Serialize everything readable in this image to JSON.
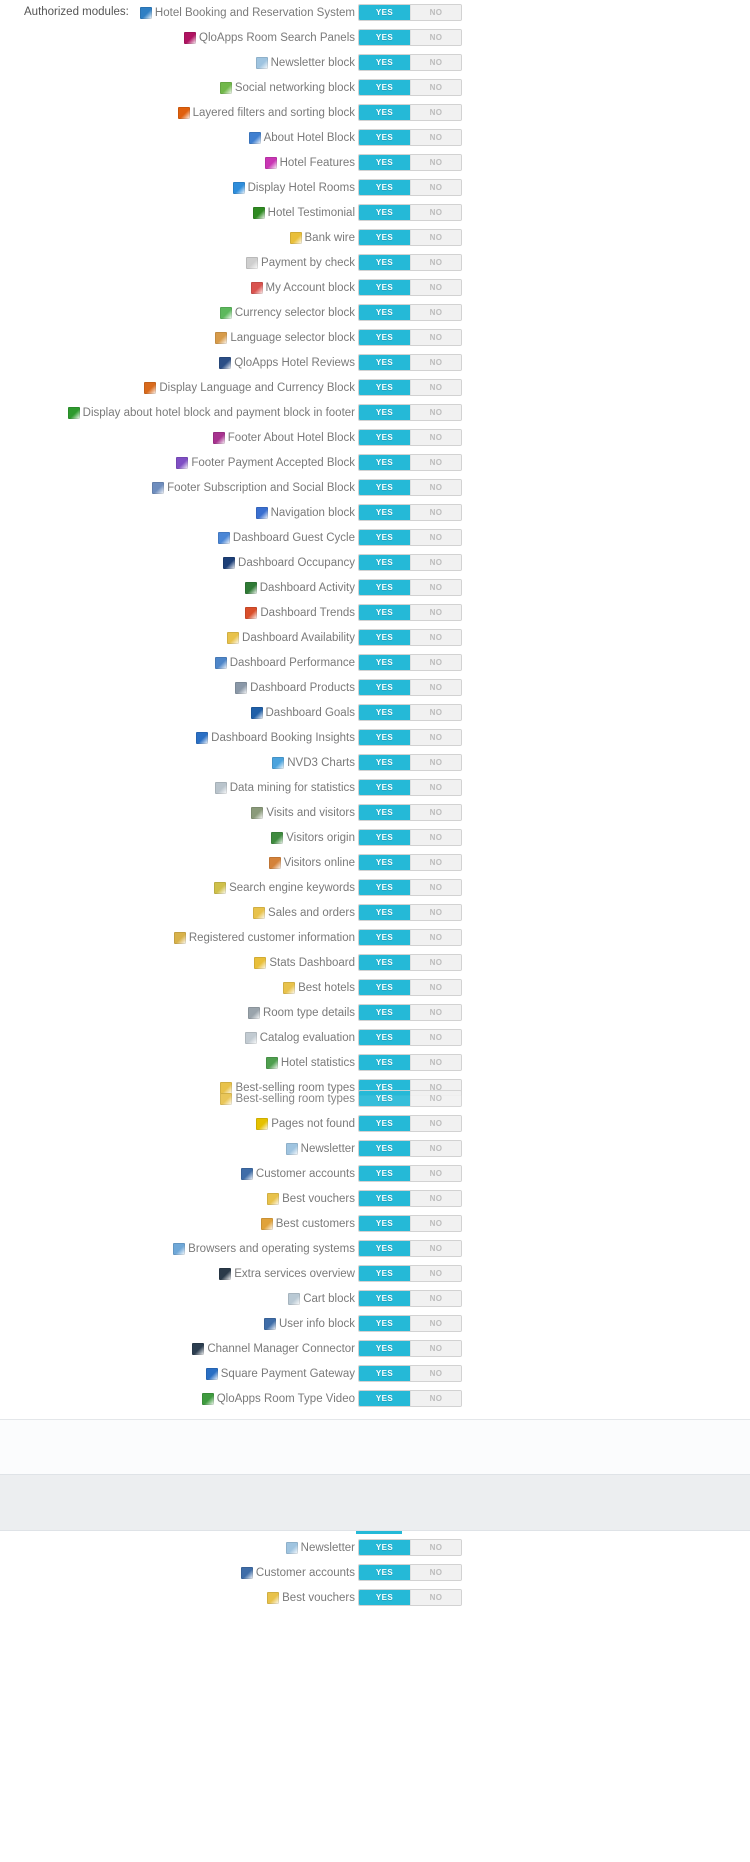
{
  "form": {
    "label": "Authorized modules:"
  },
  "toggle": {
    "yes_label": "YES",
    "no_label": "NO",
    "accent_color": "#25b9d7",
    "off_color": "#f1f1f1"
  },
  "modules": [
    {
      "name": "Hotel Booking and Reservation System",
      "icon": "hotel-booking-icon",
      "icon_color": "#2e7fc4",
      "value": "yes"
    },
    {
      "name": "QloApps Room Search Panels",
      "icon": "room-search-icon",
      "icon_color": "#b01361",
      "value": "yes"
    },
    {
      "name": "Newsletter block",
      "icon": "envelope-icon",
      "icon_color": "#9fc4e0",
      "value": "yes"
    },
    {
      "name": "Social networking block",
      "icon": "social-network-icon",
      "icon_color": "#71b84a",
      "value": "yes"
    },
    {
      "name": "Layered filters and sorting block",
      "icon": "filter-icon",
      "icon_color": "#e0600d",
      "value": "yes"
    },
    {
      "name": "About Hotel Block",
      "icon": "about-hotel-icon",
      "icon_color": "#3f7fd0",
      "value": "yes"
    },
    {
      "name": "Hotel Features",
      "icon": "hotel-features-icon",
      "icon_color": "#c936b4",
      "value": "yes"
    },
    {
      "name": "Display Hotel Rooms",
      "icon": "bed-icon",
      "icon_color": "#2e8ddb",
      "value": "yes"
    },
    {
      "name": "Hotel Testimonial",
      "icon": "testimonial-icon",
      "icon_color": "#2f8a22",
      "value": "yes"
    },
    {
      "name": "Bank wire",
      "icon": "bank-wire-icon",
      "icon_color": "#e9bf3a",
      "value": "yes"
    },
    {
      "name": "Payment by check",
      "icon": "check-payment-icon",
      "icon_color": "#cfcfcf",
      "value": "yes"
    },
    {
      "name": "My Account block",
      "icon": "my-account-icon",
      "icon_color": "#d9534f",
      "value": "yes"
    },
    {
      "name": "Currency selector block",
      "icon": "currency-icon",
      "icon_color": "#5cb85c",
      "value": "yes"
    },
    {
      "name": "Language selector block",
      "icon": "language-icon",
      "icon_color": "#d79b4a",
      "value": "yes"
    },
    {
      "name": "QloApps Hotel Reviews",
      "icon": "hotel-reviews-icon",
      "icon_color": "#2b4e86",
      "value": "yes"
    },
    {
      "name": "Display Language and Currency Block",
      "icon": "lang-currency-icon",
      "icon_color": "#d96a1c",
      "value": "yes"
    },
    {
      "name": "Display about hotel block and payment block in footer",
      "icon": "footer-about-payment-icon",
      "icon_color": "#2e9a2e",
      "value": "yes"
    },
    {
      "name": "Footer About Hotel Block",
      "icon": "footer-about-icon",
      "icon_color": "#a7338f",
      "value": "yes"
    },
    {
      "name": "Footer Payment Accepted Block",
      "icon": "payment-card-icon",
      "icon_color": "#7f4fc4",
      "value": "yes"
    },
    {
      "name": "Footer Subscription and Social Block",
      "icon": "subscription-social-icon",
      "icon_color": "#6e8dbe",
      "value": "yes"
    },
    {
      "name": "Navigation block",
      "icon": "navigation-icon",
      "icon_color": "#3a6fd0",
      "value": "yes"
    },
    {
      "name": "Dashboard Guest Cycle",
      "icon": "guest-cycle-icon",
      "icon_color": "#4a86d6",
      "value": "yes"
    },
    {
      "name": "Dashboard Occupancy",
      "icon": "occupancy-icon",
      "icon_color": "#1c3f77",
      "value": "yes"
    },
    {
      "name": "Dashboard Activity",
      "icon": "activity-icon",
      "icon_color": "#2f7a35",
      "value": "yes"
    },
    {
      "name": "Dashboard Trends",
      "icon": "trends-icon",
      "icon_color": "#d94f2b",
      "value": "yes"
    },
    {
      "name": "Dashboard Availability",
      "icon": "availability-icon",
      "icon_color": "#e8c24b",
      "value": "yes"
    },
    {
      "name": "Dashboard Performance",
      "icon": "performance-icon",
      "icon_color": "#4e86c9",
      "value": "yes"
    },
    {
      "name": "Dashboard Products",
      "icon": "products-icon",
      "icon_color": "#8a98a8",
      "value": "yes"
    },
    {
      "name": "Dashboard Goals",
      "icon": "goals-icon",
      "icon_color": "#1f5fa8",
      "value": "yes"
    },
    {
      "name": "Dashboard Booking Insights",
      "icon": "booking-insights-icon",
      "icon_color": "#2a6fc4",
      "value": "yes"
    },
    {
      "name": "NVD3 Charts",
      "icon": "nvd3-charts-icon",
      "icon_color": "#4ba3dd",
      "value": "yes"
    },
    {
      "name": "Data mining for statistics",
      "icon": "data-mining-icon",
      "icon_color": "#b9c4cc",
      "value": "yes"
    },
    {
      "name": "Visits and visitors",
      "icon": "visits-visitors-icon",
      "icon_color": "#8a9a7a",
      "value": "yes"
    },
    {
      "name": "Visitors origin",
      "icon": "visitors-origin-icon",
      "icon_color": "#3f8b3f",
      "value": "yes"
    },
    {
      "name": "Visitors online",
      "icon": "visitors-online-icon",
      "icon_color": "#d4823a",
      "value": "yes"
    },
    {
      "name": "Search engine keywords",
      "icon": "search-keywords-icon",
      "icon_color": "#cfc04a",
      "value": "yes"
    },
    {
      "name": "Sales and orders",
      "icon": "sales-orders-icon",
      "icon_color": "#e8c24b",
      "value": "yes"
    },
    {
      "name": "Registered customer information",
      "icon": "registered-customer-icon",
      "icon_color": "#d8b24a",
      "value": "yes"
    },
    {
      "name": "Stats Dashboard",
      "icon": "stats-dashboard-icon",
      "icon_color": "#e9bf3a",
      "value": "yes"
    },
    {
      "name": "Best hotels",
      "icon": "best-hotels-icon",
      "icon_color": "#e8c24b",
      "value": "yes"
    },
    {
      "name": "Room type details",
      "icon": "room-type-icon",
      "icon_color": "#9aa4ac",
      "value": "yes"
    },
    {
      "name": "Catalog evaluation",
      "icon": "catalog-evaluation-icon",
      "icon_color": "#c2cbd2",
      "value": "yes"
    },
    {
      "name": "Hotel statistics",
      "icon": "hotel-statistics-icon",
      "icon_color": "#4f9f4f",
      "value": "yes"
    },
    {
      "name": "Best-selling room types",
      "icon": "best-selling-icon",
      "icon_color": "#e8c24b",
      "value": "yes"
    },
    {
      "name": "Best-selling room types",
      "icon": "best-selling-icon",
      "icon_color": "#e8c24b",
      "value": "yes",
      "overlap": true
    },
    {
      "name": "Pages not found",
      "icon": "warning-icon",
      "icon_color": "#e5c100",
      "value": "yes"
    },
    {
      "name": "Newsletter",
      "icon": "envelope-icon",
      "icon_color": "#9fc4e0",
      "value": "yes"
    },
    {
      "name": "Customer accounts",
      "icon": "customer-account-icon",
      "icon_color": "#3f6da8",
      "value": "yes"
    },
    {
      "name": "Best vouchers",
      "icon": "voucher-icon",
      "icon_color": "#e8c24b",
      "value": "yes"
    },
    {
      "name": "Best customers",
      "icon": "best-customers-icon",
      "icon_color": "#e0a23a",
      "value": "yes"
    },
    {
      "name": "Browsers and operating systems",
      "icon": "browsers-os-icon",
      "icon_color": "#6fa8d8",
      "value": "yes"
    },
    {
      "name": "Extra services overview",
      "icon": "extra-services-icon",
      "icon_color": "#2b3a4a",
      "value": "yes"
    },
    {
      "name": "Cart block",
      "icon": "cart-icon",
      "icon_color": "#b9c9d4",
      "value": "yes"
    },
    {
      "name": "User info block",
      "icon": "user-info-icon",
      "icon_color": "#3f6da8",
      "value": "yes"
    },
    {
      "name": "Channel Manager Connector",
      "icon": "channel-manager-icon",
      "icon_color": "#2c3e50",
      "value": "yes"
    },
    {
      "name": "Square Payment Gateway",
      "icon": "square-payment-icon",
      "icon_color": "#2a6fc4",
      "value": "yes"
    },
    {
      "name": "QloApps Room Type Video",
      "icon": "room-type-video-icon",
      "icon_color": "#3f9b3f",
      "value": "yes"
    }
  ],
  "footer_modules": [
    {
      "name": "Newsletter",
      "icon": "envelope-icon",
      "icon_color": "#9fc4e0",
      "value": "yes"
    },
    {
      "name": "Customer accounts",
      "icon": "customer-account-icon",
      "icon_color": "#3f6da8",
      "value": "yes"
    },
    {
      "name": "Best vouchers",
      "icon": "voucher-icon",
      "icon_color": "#e8c24b",
      "value": "yes"
    }
  ]
}
